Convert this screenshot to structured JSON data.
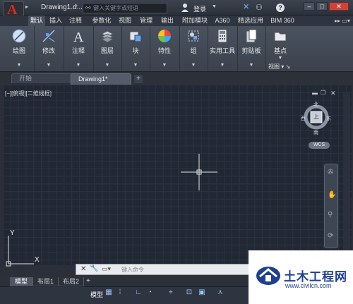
{
  "titlebar": {
    "doc_title": "Drawing1.d...",
    "search_placeholder": "键入关键字或短语",
    "login_label": "登录"
  },
  "ribbon_tabs": [
    {
      "label": "默认",
      "active": true
    },
    {
      "label": "插入"
    },
    {
      "label": "注释"
    },
    {
      "label": "参数化"
    },
    {
      "label": "视图"
    },
    {
      "label": "管理"
    },
    {
      "label": "输出"
    },
    {
      "label": "附加模块"
    },
    {
      "label": "A360"
    },
    {
      "label": "精选应用"
    },
    {
      "label": "BIM 360"
    }
  ],
  "ribbon_panels": [
    {
      "label": "绘图",
      "icon": "draw-icon"
    },
    {
      "label": "修改",
      "icon": "modify-icon"
    },
    {
      "label": "注释",
      "icon": "annotation-icon"
    },
    {
      "label": "图层",
      "icon": "layers-icon"
    },
    {
      "label": "块",
      "icon": "block-icon"
    },
    {
      "label": "特性",
      "icon": "properties-icon"
    },
    {
      "label": "组",
      "icon": "group-icon"
    },
    {
      "label": "实用工具",
      "icon": "utilities-icon"
    },
    {
      "label": "剪贴板",
      "icon": "clipboard-icon"
    },
    {
      "label": "基点",
      "icon": "base-point-icon"
    }
  ],
  "view_panel_label": "视图",
  "file_tabs": {
    "start": "开始",
    "drawing": "Drawing1*"
  },
  "viewport_label": "[−][俯视][二维线框]",
  "viewcube": {
    "top": "上",
    "north": "北",
    "south": "南",
    "east": "东",
    "west": "西",
    "wcs": "WCS"
  },
  "ucs": {
    "x": "X",
    "y": "Y"
  },
  "command_line": {
    "placeholder": "键入命令"
  },
  "layout_tabs": [
    {
      "label": "模型",
      "active": true
    },
    {
      "label": "布局1"
    },
    {
      "label": "布局2"
    }
  ],
  "statusbar": {
    "model_label": "模型"
  },
  "watermark": {
    "main": "土木工程网",
    "url": "www.civilcn.com"
  },
  "colors": {
    "accent": "#d52b1e",
    "canvas": "#212834",
    "watermark": "#1f3f8f"
  }
}
